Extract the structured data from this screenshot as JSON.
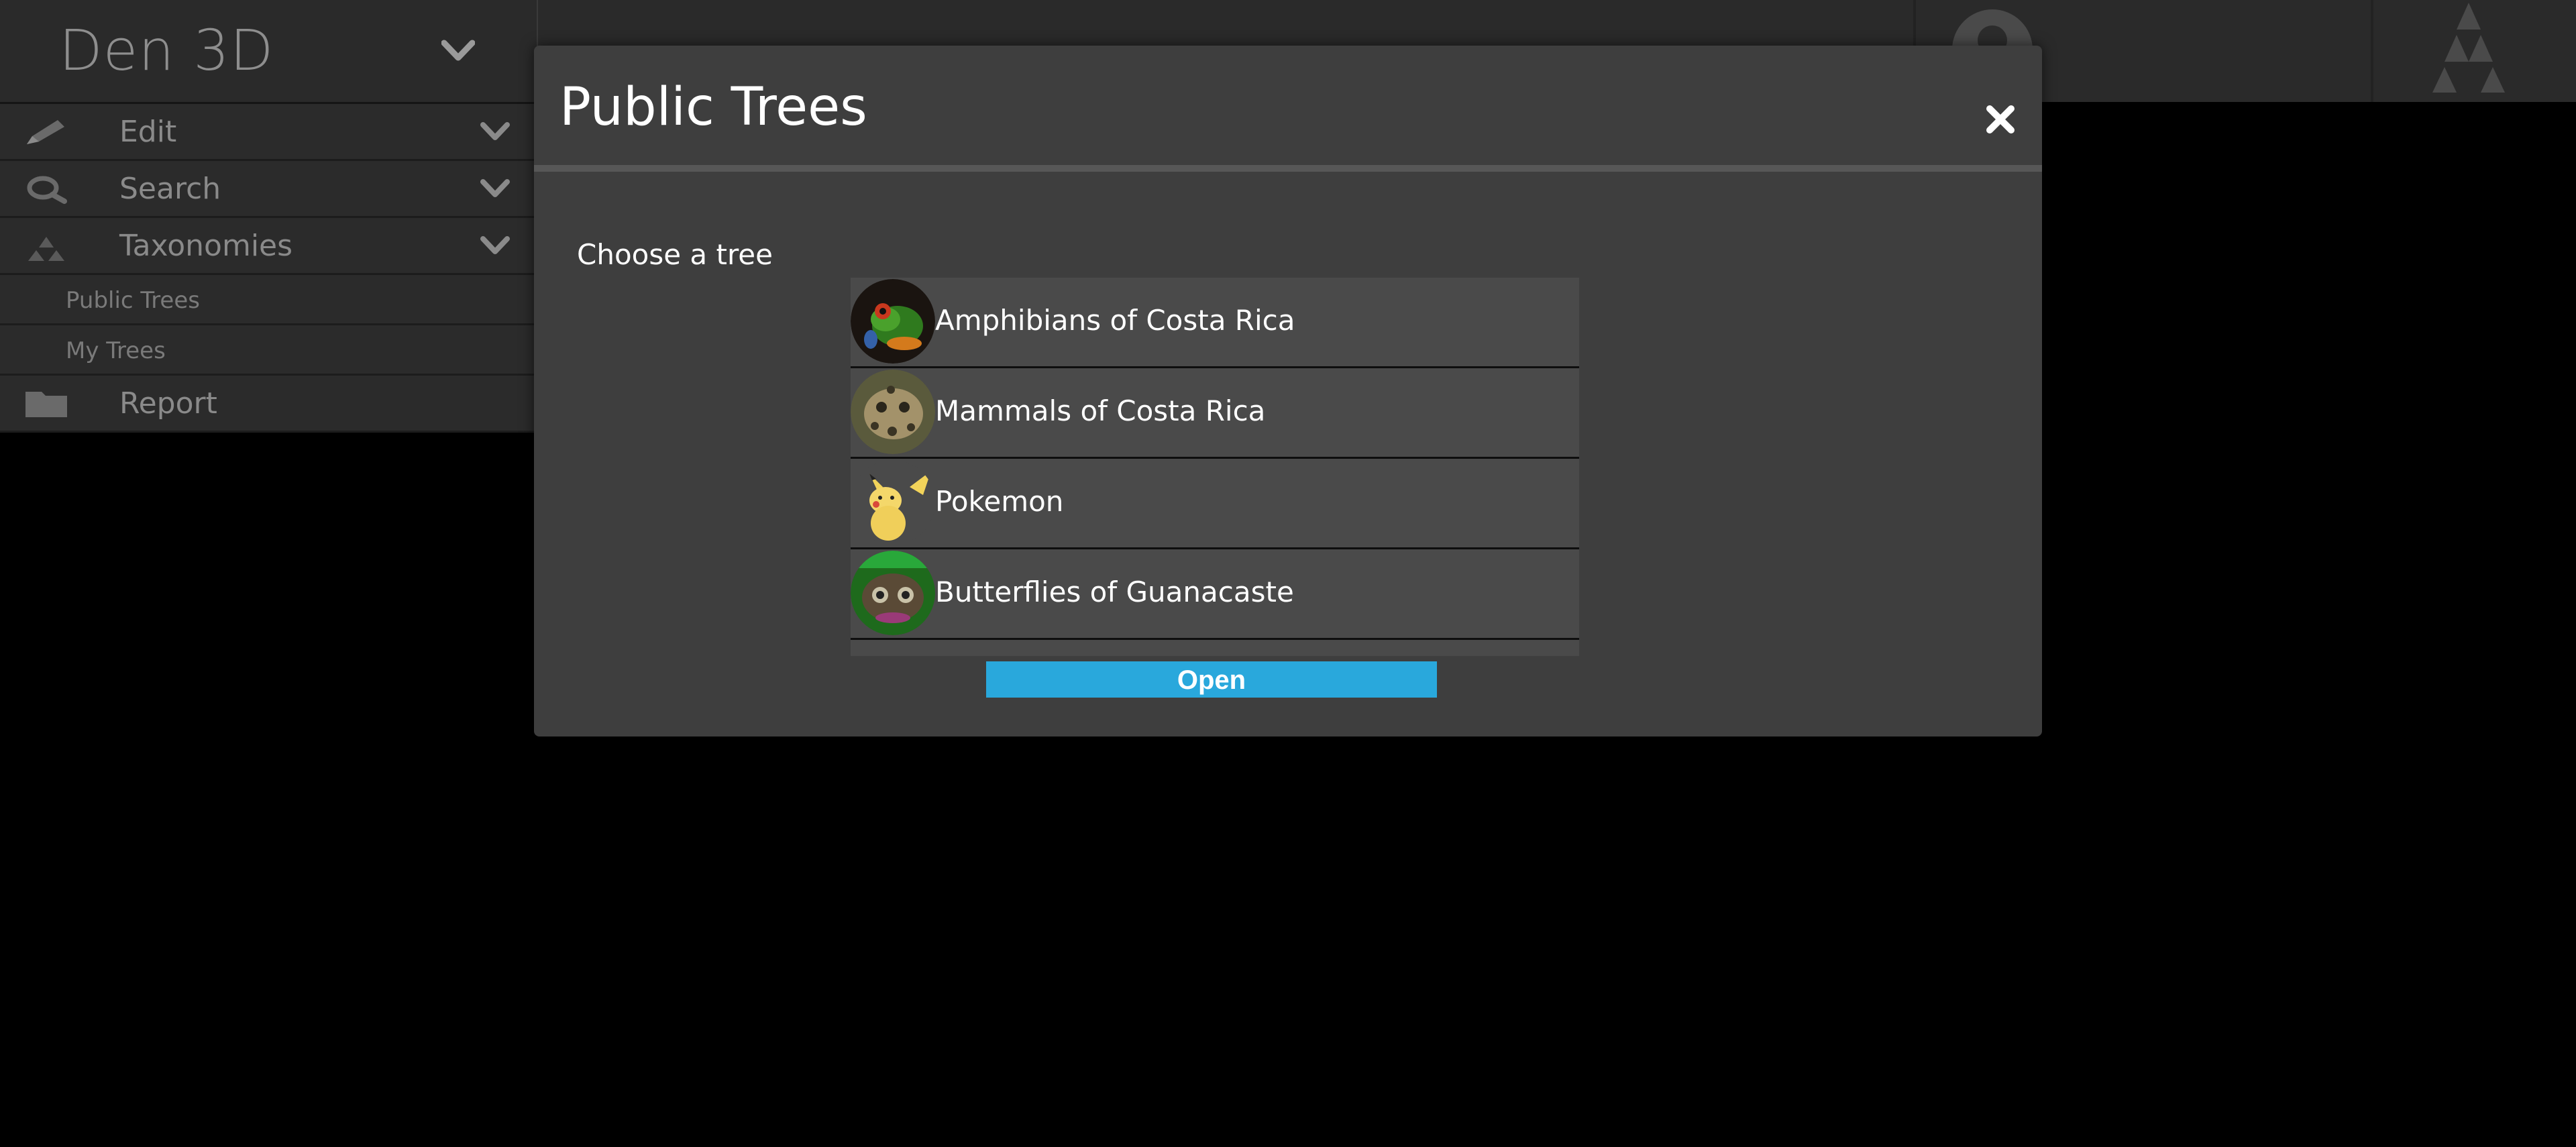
{
  "app": {
    "title": "Den 3D"
  },
  "sidebar": {
    "items": [
      {
        "label": "Edit",
        "icon": "pencil-icon"
      },
      {
        "label": "Search",
        "icon": "magnifier-icon"
      },
      {
        "label": "Taxonomies",
        "icon": "tree-icon"
      }
    ],
    "sub_items": [
      {
        "label": "Public Trees"
      },
      {
        "label": "My Trees"
      }
    ],
    "report": {
      "label": "Report",
      "icon": "folder-icon"
    }
  },
  "modal": {
    "title": "Public Trees",
    "close_icon": "close-icon",
    "choose_label": "Choose a tree",
    "trees": [
      {
        "name": "Amphibians of Costa Rica",
        "thumb": "frog"
      },
      {
        "name": "Mammals of Costa Rica",
        "thumb": "ocelot"
      },
      {
        "name": "Pokemon",
        "thumb": "pikachu"
      },
      {
        "name": "Butterflies of Guanacaste",
        "thumb": "butterfly"
      }
    ],
    "open_label": "Open"
  },
  "colors": {
    "accent": "#29a8dc",
    "modal_bg": "#3e3e3e",
    "sidebar_bg": "#2b2b2b",
    "page_bg": "#000000"
  }
}
